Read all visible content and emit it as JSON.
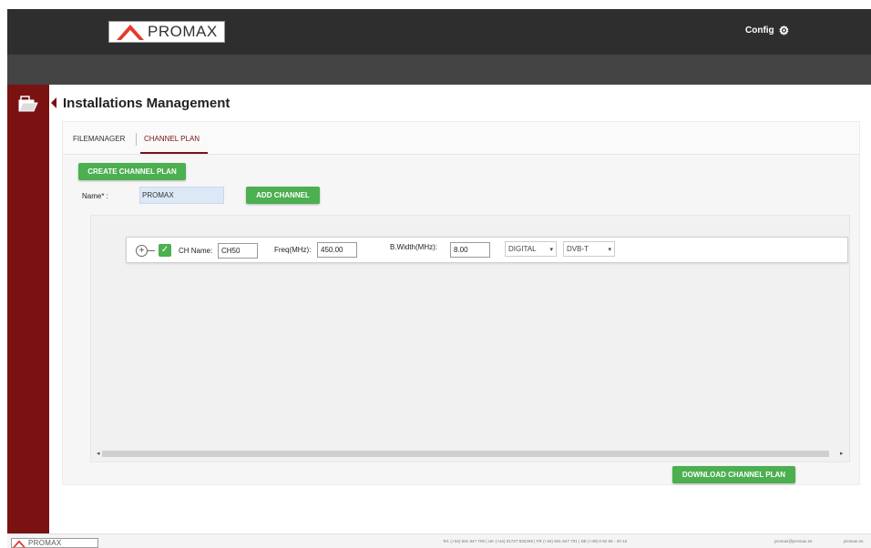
{
  "header": {
    "brand": "PROMAX",
    "config_label": "Config",
    "config_icon": "gear-icon",
    "brand_color": "#e53a2b"
  },
  "sidebar": {
    "items": [
      {
        "icon": "folder-icon"
      }
    ],
    "color": "#7a1212"
  },
  "page": {
    "title": "Installations Management"
  },
  "tabs": [
    {
      "label": "FILEMANAGER"
    },
    {
      "label": "CHANNEL PLAN"
    }
  ],
  "form": {
    "create_button": "CREATE CHANNEL PLAN",
    "name_label": "Name* :",
    "name_value": "PROMAX",
    "add_channel_button": "ADD CHANNEL",
    "download_button": "DOWNLOAD CHANNEL PLAN",
    "accent": "#4caf50"
  },
  "channels": [
    {
      "ch_name_label": "CH Name:",
      "ch_name_value": "CH50",
      "freq_label": "Freq(MHz):",
      "freq_value": "450.00",
      "bw_label": "B.Width(MHz):",
      "bw_value": "8.00",
      "signal_type": "DIGITAL",
      "standard": "DVB-T",
      "checked": true
    }
  ],
  "footer": {
    "brand": "PROMAX",
    "contacts": "Tel. (+34) 931 847 700   |   UK (+44) 01727 832266   |   FR (+34) 931 847 701   |   DE (+49) 0 62 55 - 20 42",
    "email": "promax@promax.es",
    "site": "promax.es"
  }
}
